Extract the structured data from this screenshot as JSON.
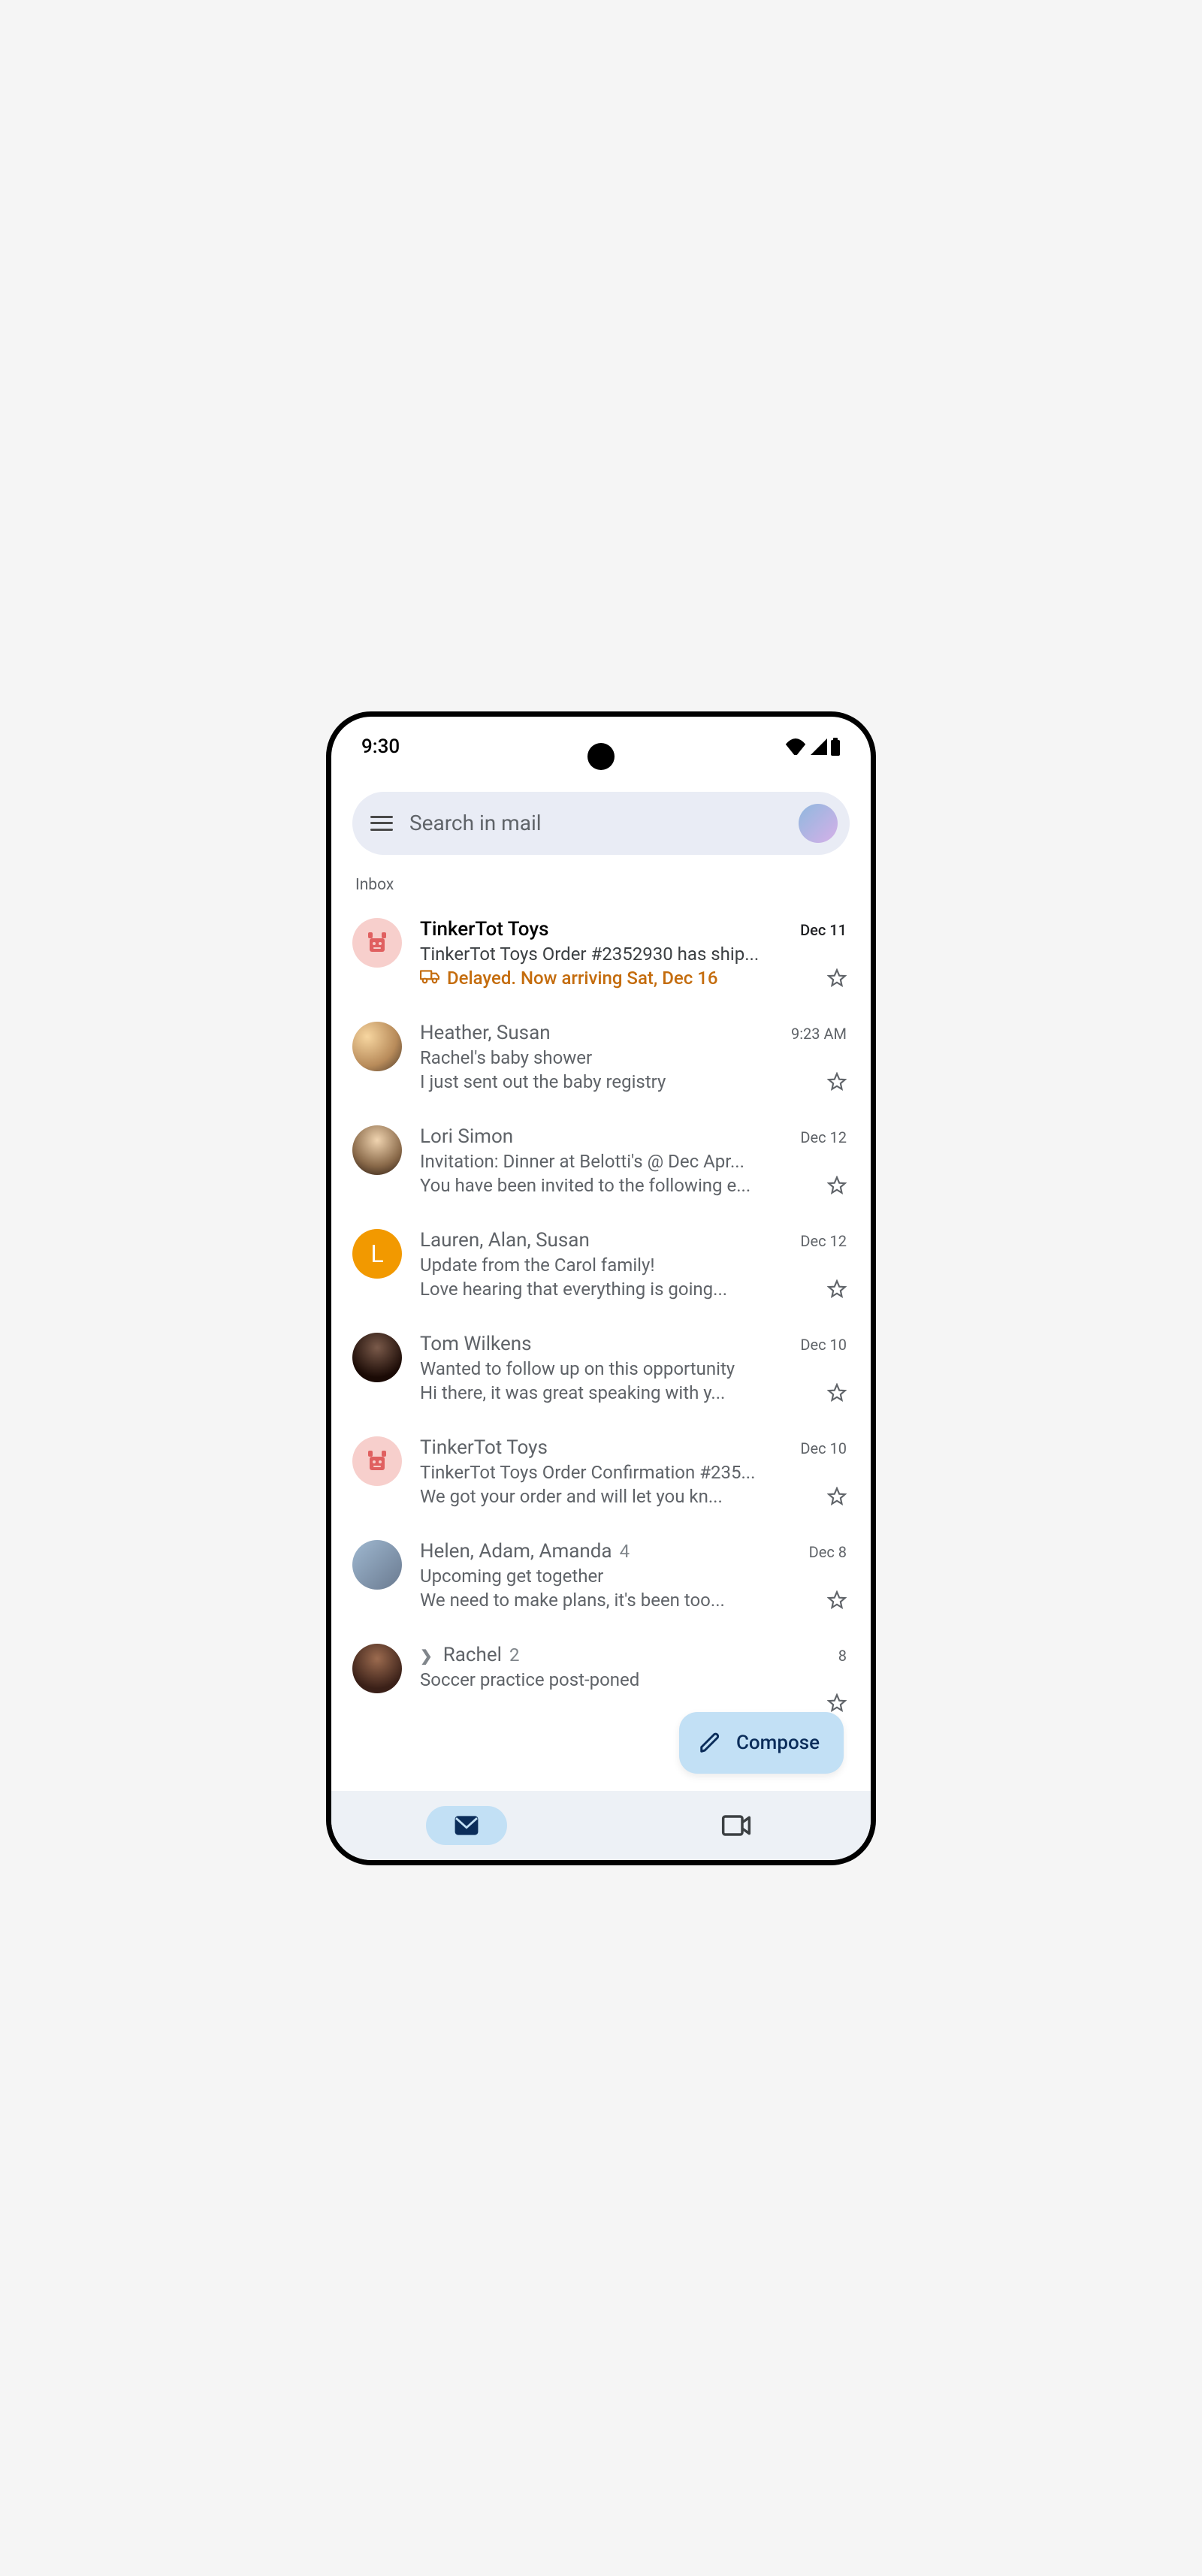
{
  "status": {
    "time": "9:30"
  },
  "search": {
    "placeholder": "Search in mail"
  },
  "section": "Inbox",
  "compose_label": "Compose",
  "colors": {
    "delay": "#c46c0d",
    "letter_avatar_bg": "#f29900",
    "robot_bg": "#f7cfcc",
    "compose_bg": "#c2e0f5",
    "compose_fg": "#0b2d5a"
  },
  "emails": [
    {
      "sender": "TinkerTot Toys",
      "date": "Dec 11",
      "subject": "TinkerTot Toys Order #2352930 has ship...",
      "delay_text": "Delayed. Now arriving Sat, Dec 16",
      "avatar_type": "robot",
      "unread": true
    },
    {
      "sender": "Heather, Susan",
      "date": "9:23 AM",
      "subject": "Rachel's baby shower",
      "snippet": "I just sent out the baby registry",
      "avatar_type": "photo",
      "avatar_class": "photo-b",
      "unread": false
    },
    {
      "sender": "Lori Simon",
      "date": "Dec 12",
      "subject": "Invitation: Dinner at Belotti's @ Dec Apr...",
      "snippet": "You have been invited to the following e...",
      "avatar_type": "photo",
      "avatar_class": "photo-c",
      "unread": false
    },
    {
      "sender": "Lauren, Alan, Susan",
      "date": "Dec 12",
      "subject": "Update from the Carol family!",
      "snippet": "Love hearing that everything is going...",
      "avatar_type": "letter",
      "avatar_letter": "L",
      "unread": false
    },
    {
      "sender": "Tom Wilkens",
      "date": "Dec 10",
      "subject": "Wanted to follow up on this opportunity",
      "snippet": "Hi there, it was great speaking with y...",
      "avatar_type": "photo",
      "avatar_class": "photo-d",
      "unread": false
    },
    {
      "sender": "TinkerTot Toys",
      "date": "Dec 10",
      "subject": "TinkerTot Toys Order Confirmation #235...",
      "snippet": "We got your order and will let you kn...",
      "avatar_type": "robot",
      "unread": false
    },
    {
      "sender": "Helen, Adam, Amanda",
      "thread_count": "4",
      "date": "Dec 8",
      "subject": "Upcoming get together",
      "snippet": "We need to make plans, it's been too...",
      "avatar_type": "photo",
      "avatar_class": "photo-e",
      "unread": false
    },
    {
      "sender": "Rachel",
      "thread_count": "2",
      "reply_indicator": true,
      "date": "8",
      "subject": "Soccer practice post-poned",
      "snippet": "",
      "avatar_type": "photo",
      "avatar_class": "photo-f",
      "unread": false
    }
  ]
}
